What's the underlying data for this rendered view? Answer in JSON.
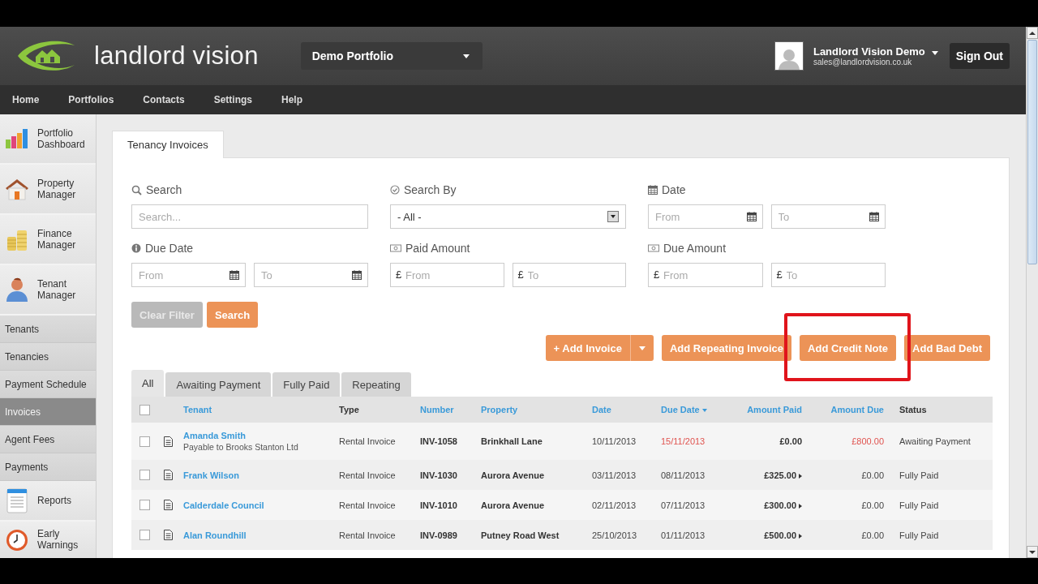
{
  "header": {
    "logo_text": "landlord vision",
    "portfolio": "Demo Portfolio",
    "user_name": "Landlord Vision Demo",
    "user_email": "sales@landlordvision.co.uk",
    "sign_out": "Sign Out"
  },
  "nav": [
    "Home",
    "Portfolios",
    "Contacts",
    "Settings",
    "Help"
  ],
  "sidebar": {
    "items": [
      {
        "label": "Portfolio Dashboard",
        "kind": "dashboard",
        "selected": false
      },
      {
        "label": "Property Manager",
        "kind": "property",
        "selected": false
      },
      {
        "label": "Finance Manager",
        "kind": "finance",
        "selected": false
      },
      {
        "label": "Tenant Manager",
        "kind": "tenant",
        "selected": false
      },
      {
        "label": "Tenants",
        "kind": "link",
        "selected": false
      },
      {
        "label": "Tenancies",
        "kind": "link",
        "selected": false
      },
      {
        "label": "Payment Schedule",
        "kind": "link",
        "selected": false
      },
      {
        "label": "Invoices",
        "kind": "link",
        "selected": true
      },
      {
        "label": "Agent Fees",
        "kind": "link",
        "selected": false
      },
      {
        "label": "Payments",
        "kind": "link",
        "selected": false
      },
      {
        "label": "Reports",
        "kind": "reports",
        "selected": false
      },
      {
        "label": "Early Warnings",
        "kind": "warnings",
        "selected": false
      }
    ]
  },
  "page_tab": "Tenancy Invoices",
  "filters": [
    {
      "label": "Search",
      "fields": [
        {
          "kind": "text",
          "placeholder": "Search..."
        }
      ]
    },
    {
      "label": "Search By",
      "fields": [
        {
          "kind": "select",
          "value": "- All -"
        }
      ]
    },
    {
      "label": "Date",
      "fields": [
        {
          "kind": "date",
          "placeholder": "From"
        },
        {
          "kind": "date",
          "placeholder": "To"
        }
      ]
    },
    {
      "label": "Due Date",
      "fields": [
        {
          "kind": "date",
          "placeholder": "From"
        },
        {
          "kind": "date",
          "placeholder": "To"
        }
      ]
    },
    {
      "label": "Paid Amount",
      "fields": [
        {
          "kind": "money",
          "prefix": "£",
          "placeholder": "From"
        },
        {
          "kind": "money",
          "prefix": "£",
          "placeholder": "To"
        }
      ]
    },
    {
      "label": "Due Amount",
      "fields": [
        {
          "kind": "money",
          "prefix": "£",
          "placeholder": "From"
        },
        {
          "kind": "money",
          "prefix": "£",
          "placeholder": "To"
        }
      ]
    }
  ],
  "filter_buttons": [
    {
      "label": "Clear Filter",
      "disabled": true
    },
    {
      "label": "Search",
      "disabled": false
    }
  ],
  "actions": [
    {
      "label": "+ Add Invoice",
      "menu": true
    },
    {
      "label": "Add Repeating Invoice",
      "menu": false
    },
    {
      "label": "Add Credit Note",
      "menu": false
    },
    {
      "label": "Add Bad Debt",
      "menu": false
    }
  ],
  "status_tabs": [
    {
      "label": "All",
      "selected": true
    },
    {
      "label": "Awaiting Payment",
      "selected": false
    },
    {
      "label": "Fully Paid",
      "selected": false
    },
    {
      "label": "Repeating",
      "selected": false
    }
  ],
  "table": {
    "select_all_checked": false,
    "columns": [
      {
        "label": "Tenant",
        "sortable": true,
        "sorted": false
      },
      {
        "label": "Type",
        "sortable": false,
        "sorted": false
      },
      {
        "label": "Number",
        "sortable": true,
        "sorted": false
      },
      {
        "label": "Property",
        "sortable": true,
        "sorted": false
      },
      {
        "label": "Date",
        "sortable": true,
        "sorted": false
      },
      {
        "label": "Due Date",
        "sortable": true,
        "sorted": true
      },
      {
        "label": "Amount Paid",
        "sortable": true,
        "sorted": false
      },
      {
        "label": "Amount Due",
        "sortable": true,
        "sorted": false
      },
      {
        "label": "Status",
        "sortable": false,
        "sorted": false
      }
    ],
    "rows": [
      {
        "checked": false,
        "tenant": "Amanda Smith",
        "note": "Payable to Brooks Stanton Ltd",
        "type": "Rental Invoice",
        "number": "INV-1058",
        "property": "Brinkhall Lane",
        "date": "10/11/2013",
        "due_date": "15/11/2013",
        "overdue": true,
        "amount_paid": "£0.00",
        "paid_detail": false,
        "amount_due": "£800.00",
        "status": "Awaiting Payment"
      },
      {
        "checked": false,
        "tenant": "Frank Wilson",
        "type": "Rental Invoice",
        "number": "INV-1030",
        "property": "Aurora Avenue",
        "date": "03/11/2013",
        "due_date": "08/11/2013",
        "overdue": false,
        "amount_paid": "£325.00",
        "paid_detail": true,
        "amount_due": "£0.00",
        "status": "Fully Paid"
      },
      {
        "checked": false,
        "tenant": "Calderdale Council",
        "type": "Rental Invoice",
        "number": "INV-1010",
        "property": "Aurora Avenue",
        "date": "02/11/2013",
        "due_date": "07/11/2013",
        "overdue": false,
        "amount_paid": "£300.00",
        "paid_detail": true,
        "amount_due": "£0.00",
        "status": "Fully Paid"
      },
      {
        "checked": false,
        "tenant": "Alan Roundhill",
        "type": "Rental Invoice",
        "number": "INV-0989",
        "property": "Putney Road West",
        "date": "25/10/2013",
        "due_date": "01/11/2013",
        "overdue": false,
        "amount_paid": "£500.00",
        "paid_detail": true,
        "amount_due": "£0.00",
        "status": "Fully Paid"
      }
    ]
  }
}
